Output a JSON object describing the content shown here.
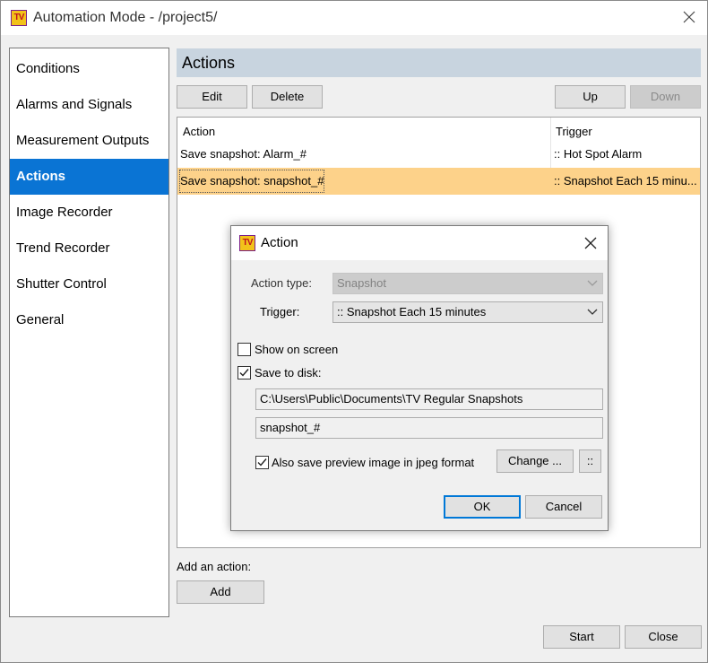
{
  "window": {
    "title": "Automation Mode - /project5/",
    "logo_text": "TV"
  },
  "sidebar": {
    "items": [
      {
        "label": "Conditions"
      },
      {
        "label": "Alarms and Signals"
      },
      {
        "label": "Measurement Outputs"
      },
      {
        "label": "Actions",
        "active": true
      },
      {
        "label": "Image Recorder"
      },
      {
        "label": "Trend Recorder"
      },
      {
        "label": "Shutter Control"
      },
      {
        "label": "General"
      }
    ]
  },
  "actions": {
    "header": "Actions",
    "buttons": {
      "edit": "Edit",
      "delete": "Delete",
      "up": "Up",
      "down": "Down"
    },
    "table": {
      "columns": [
        "Action",
        "Trigger"
      ],
      "rows": [
        {
          "action": "Save snapshot: Alarm_#",
          "trigger": ":: Hot Spot Alarm"
        },
        {
          "action": "Save snapshot: snapshot_#",
          "trigger": ":: Snapshot Each 15 minu...",
          "selected": true
        }
      ]
    },
    "add_label": "Add an action:",
    "add_button": "Add"
  },
  "footer": {
    "start": "Start",
    "close": "Close"
  },
  "dialog": {
    "title": "Action",
    "logo_text": "TV",
    "action_type_label": "Action type:",
    "action_type_value": "Snapshot",
    "trigger_label": "Trigger:",
    "trigger_value": ":: Snapshot Each 15 minutes",
    "show_on_screen": {
      "label": "Show on screen",
      "checked": false
    },
    "save_to_disk": {
      "label": "Save to disk:",
      "checked": true
    },
    "path": "C:\\Users\\Public\\Documents\\TV Regular Snapshots",
    "filename": "snapshot_#",
    "jpeg": {
      "label": "Also save preview image in jpeg format",
      "checked": true
    },
    "change_button": "Change ...",
    "extra_button": "::",
    "ok": "OK",
    "cancel": "Cancel"
  },
  "colors": {
    "accent": "#0a74d4",
    "selected_row": "#fdd28a",
    "section_header": "#c8d4df"
  }
}
